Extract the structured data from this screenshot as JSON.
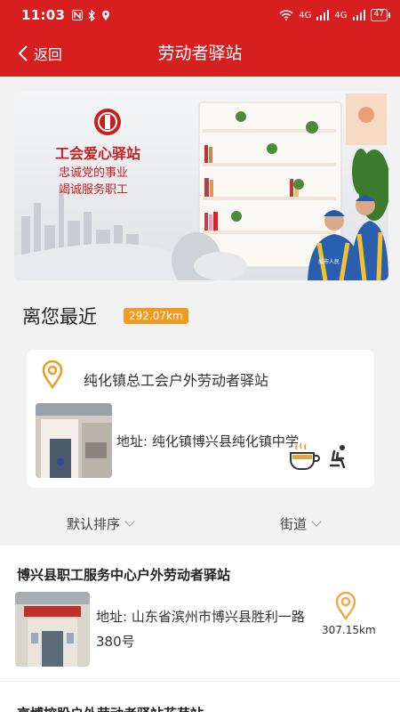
{
  "status_bar": {
    "time": "11:03",
    "left_icons": [
      "n-icon",
      "bluetooth-icon",
      "location-icon"
    ],
    "net_label_1": "4G",
    "net_label_2": "4G",
    "battery": "47"
  },
  "nav": {
    "back_label": "返回",
    "title": "劳动者驿站"
  },
  "banner": {
    "sign_title": "工会爱心驿站",
    "sign_line1": "忠诚党的事业",
    "sign_line2": "竭诚服务职工",
    "worker_vest_text": "城市人民"
  },
  "nearest": {
    "title": "离您最近",
    "distance": "292.07km",
    "card": {
      "name": "纯化镇总工会户外劳动者驿站",
      "address": "地址: 纯化镇博兴县纯化镇中学",
      "amenities": [
        "hot-drink-icon",
        "seat-icon"
      ]
    }
  },
  "sort": {
    "default_label": "默认排序",
    "street_label": "街道"
  },
  "list": [
    {
      "name": "博兴县职工服务中心户外劳动者驿站",
      "address": "地址: 山东省滨州市博兴县胜利一路380号",
      "distance": "307.15km"
    },
    {
      "name": "京博控股户外劳动者驿站花苑站"
    }
  ],
  "colors": {
    "brand_red": "#d71f1f",
    "accent_orange": "#f29a1f",
    "pin_orange": "#f5a94a"
  }
}
